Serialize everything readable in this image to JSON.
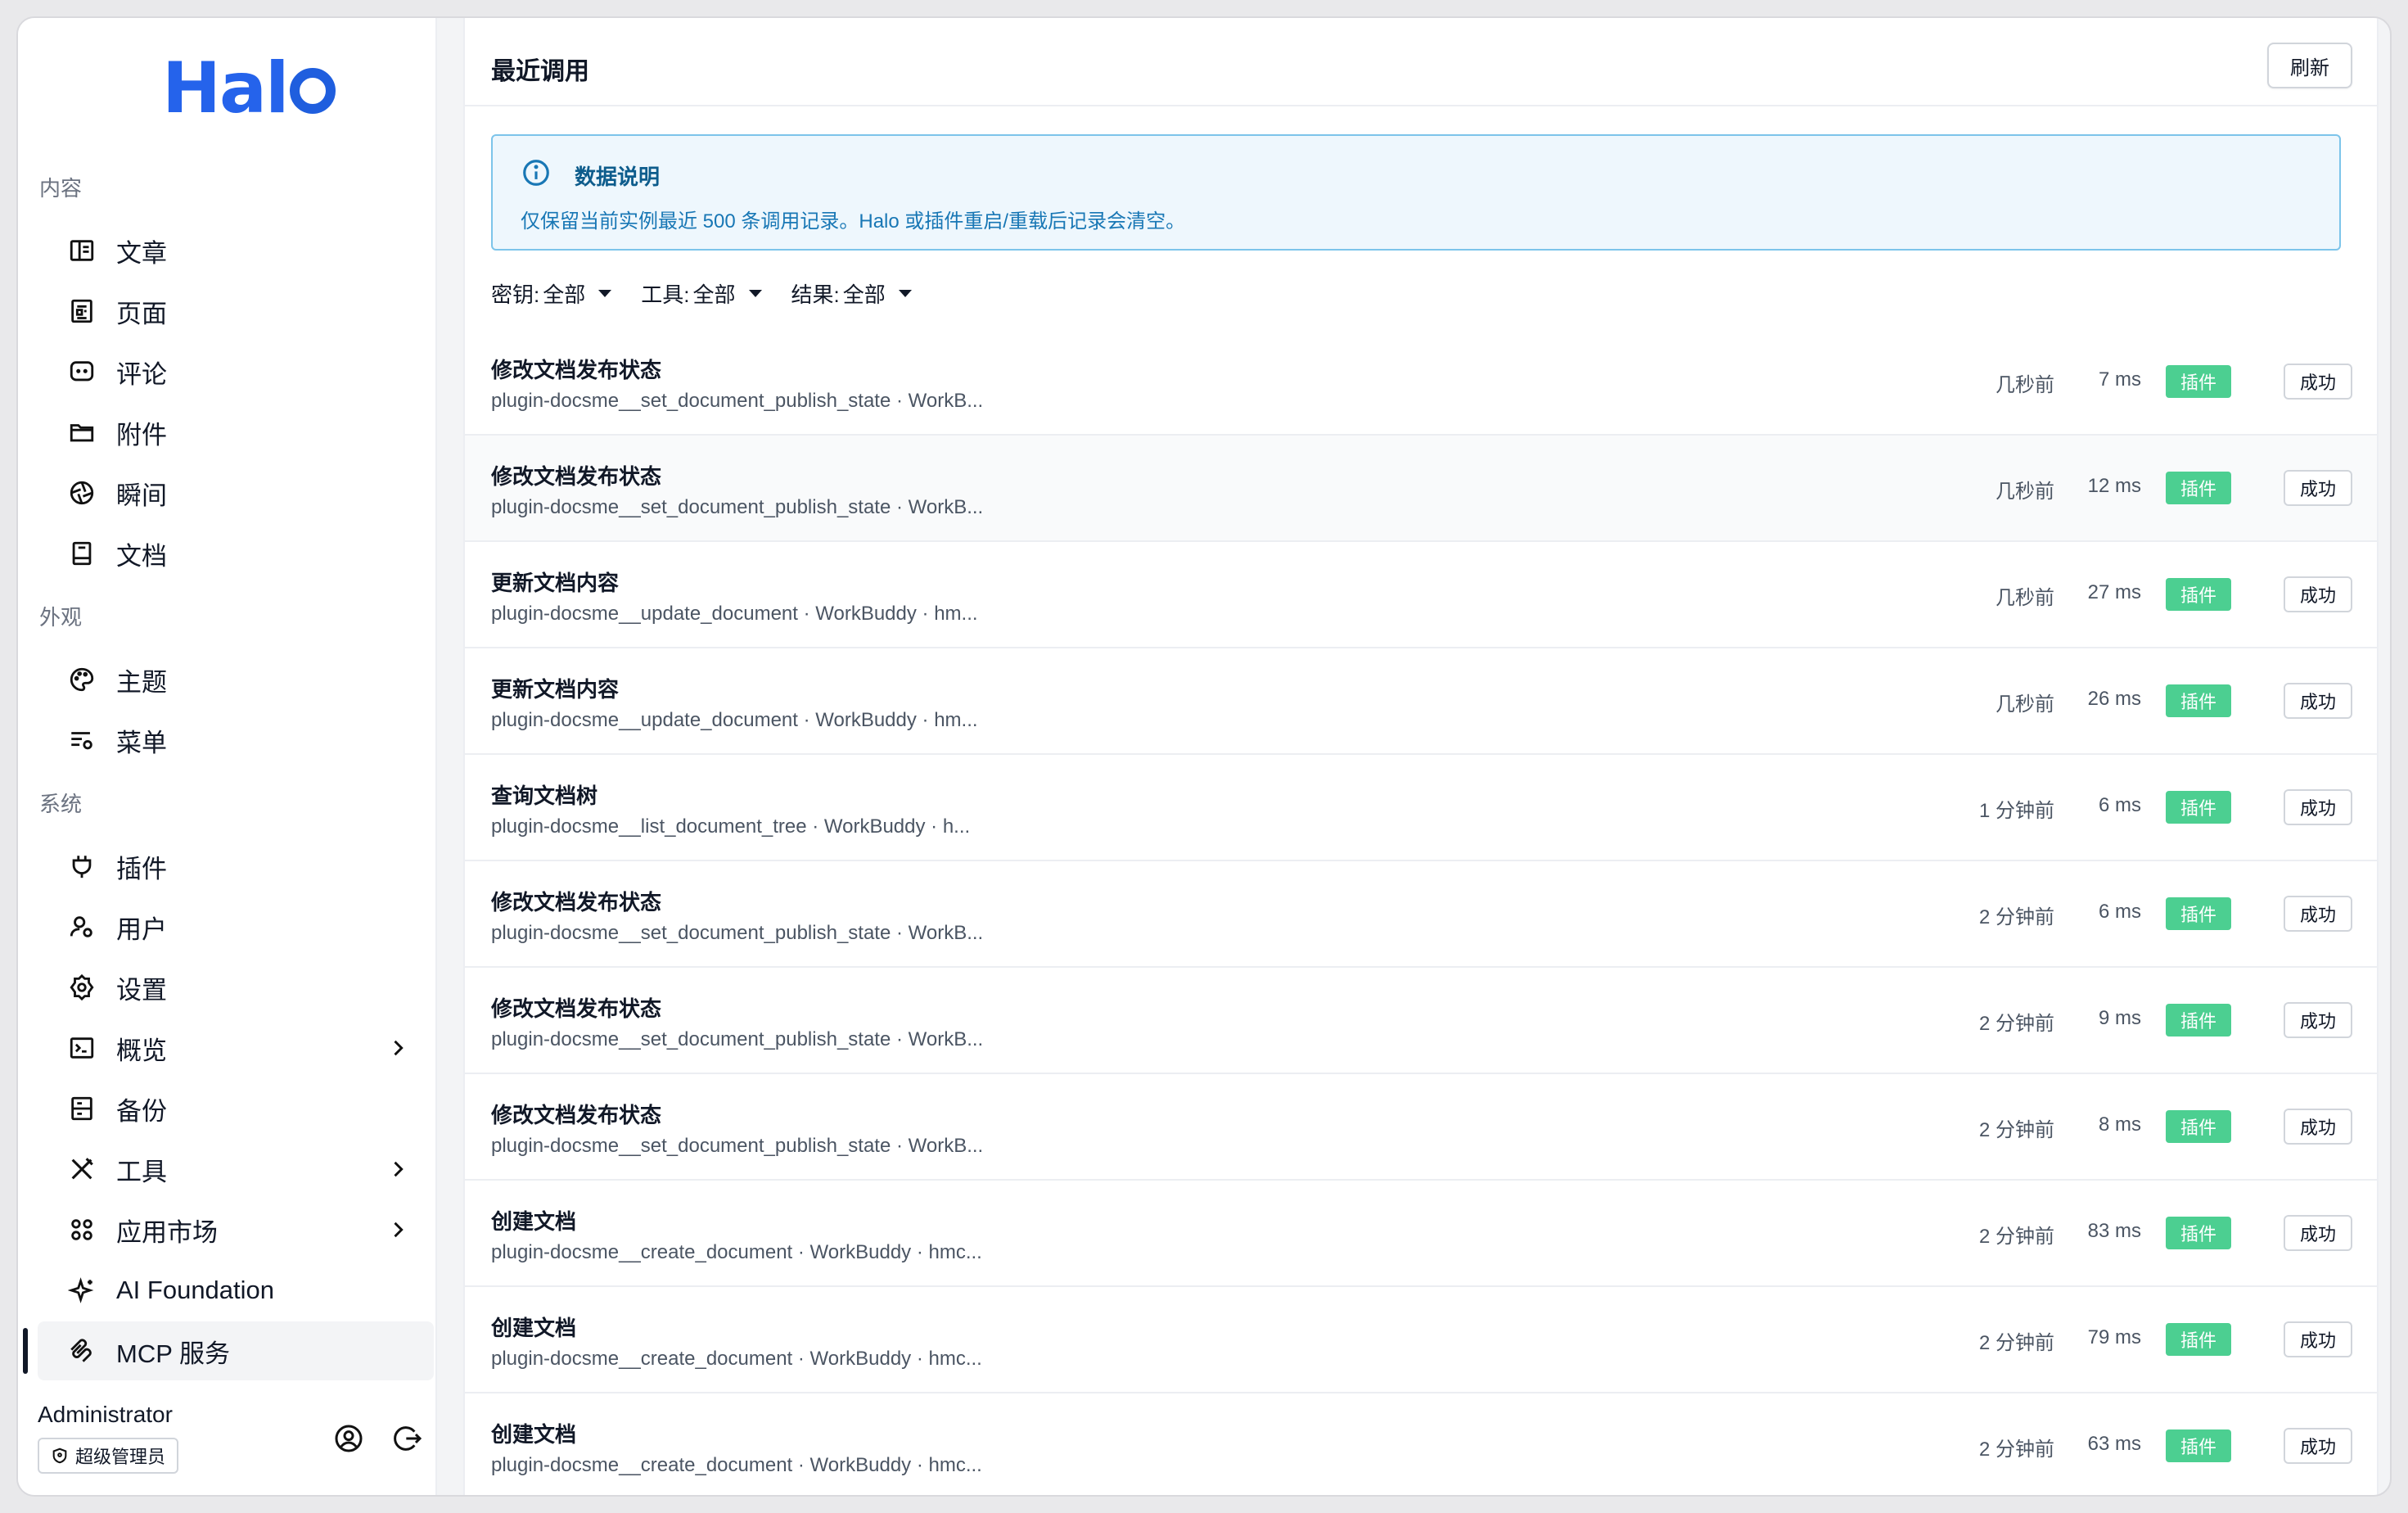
{
  "app": {
    "logo_text": "Halo"
  },
  "sidebar": {
    "groups": {
      "content": "内容",
      "appearance": "外观",
      "system": "系统"
    },
    "items": [
      {
        "key": "posts",
        "label": "文章",
        "icon": "book-open-icon"
      },
      {
        "key": "pages",
        "label": "页面",
        "icon": "page-icon"
      },
      {
        "key": "comments",
        "label": "评论",
        "icon": "comment-icon"
      },
      {
        "key": "attachments",
        "label": "附件",
        "icon": "folder-icon"
      },
      {
        "key": "moments",
        "label": "瞬间",
        "icon": "aperture-icon"
      },
      {
        "key": "docs",
        "label": "文档",
        "icon": "notebook-icon"
      },
      {
        "key": "themes",
        "label": "主题",
        "icon": "palette-icon"
      },
      {
        "key": "menus",
        "label": "菜单",
        "icon": "menu-settings-icon"
      },
      {
        "key": "plugins",
        "label": "插件",
        "icon": "plug-icon"
      },
      {
        "key": "users",
        "label": "用户",
        "icon": "user-settings-icon"
      },
      {
        "key": "settings",
        "label": "设置",
        "icon": "gear-icon"
      },
      {
        "key": "overview",
        "label": "概览",
        "icon": "terminal-icon"
      },
      {
        "key": "backup",
        "label": "备份",
        "icon": "archive-icon"
      },
      {
        "key": "tools",
        "label": "工具",
        "icon": "tools-icon"
      },
      {
        "key": "market",
        "label": "应用市场",
        "icon": "apps-grid-icon"
      },
      {
        "key": "ai",
        "label": "AI Foundation",
        "icon": "sparkle-icon"
      },
      {
        "key": "mcp",
        "label": "MCP 服务",
        "icon": "mcp-icon"
      }
    ],
    "user": {
      "name": "Administrator",
      "role": "超级管理员"
    }
  },
  "main": {
    "title": "最近调用",
    "refresh_label": "刷新",
    "notice": {
      "title": "数据说明",
      "body": "仅保留当前实例最近 500 条调用记录。Halo 或插件重启/重载后记录会清空。"
    },
    "filters": [
      {
        "label": "密钥:",
        "value": "全部"
      },
      {
        "label": "工具:",
        "value": "全部"
      },
      {
        "label": "结果:",
        "value": "全部"
      }
    ],
    "rows": [
      {
        "title": "修改文档发布状态",
        "sub": "plugin-docsme__set_document_publish_state · WorkB...",
        "time": "几秒前",
        "duration": "7 ms",
        "tag": "插件",
        "status": "成功"
      },
      {
        "title": "修改文档发布状态",
        "sub": "plugin-docsme__set_document_publish_state · WorkB...",
        "time": "几秒前",
        "duration": "12 ms",
        "tag": "插件",
        "status": "成功"
      },
      {
        "title": "更新文档内容",
        "sub": "plugin-docsme__update_document · WorkBuddy · hm...",
        "time": "几秒前",
        "duration": "27 ms",
        "tag": "插件",
        "status": "成功"
      },
      {
        "title": "更新文档内容",
        "sub": "plugin-docsme__update_document · WorkBuddy · hm...",
        "time": "几秒前",
        "duration": "26 ms",
        "tag": "插件",
        "status": "成功"
      },
      {
        "title": "查询文档树",
        "sub": "plugin-docsme__list_document_tree · WorkBuddy · h...",
        "time": "1 分钟前",
        "duration": "6 ms",
        "tag": "插件",
        "status": "成功"
      },
      {
        "title": "修改文档发布状态",
        "sub": "plugin-docsme__set_document_publish_state · WorkB...",
        "time": "2 分钟前",
        "duration": "6 ms",
        "tag": "插件",
        "status": "成功"
      },
      {
        "title": "修改文档发布状态",
        "sub": "plugin-docsme__set_document_publish_state · WorkB...",
        "time": "2 分钟前",
        "duration": "9 ms",
        "tag": "插件",
        "status": "成功"
      },
      {
        "title": "修改文档发布状态",
        "sub": "plugin-docsme__set_document_publish_state · WorkB...",
        "time": "2 分钟前",
        "duration": "8 ms",
        "tag": "插件",
        "status": "成功"
      },
      {
        "title": "创建文档",
        "sub": "plugin-docsme__create_document · WorkBuddy · hmc...",
        "time": "2 分钟前",
        "duration": "83 ms",
        "tag": "插件",
        "status": "成功"
      },
      {
        "title": "创建文档",
        "sub": "plugin-docsme__create_document · WorkBuddy · hmc...",
        "time": "2 分钟前",
        "duration": "79 ms",
        "tag": "插件",
        "status": "成功"
      },
      {
        "title": "创建文档",
        "sub": "plugin-docsme__create_document · WorkBuddy · hmc...",
        "time": "2 分钟前",
        "duration": "63 ms",
        "tag": "插件",
        "status": "成功"
      }
    ]
  },
  "colors": {
    "brand": "#2563eb",
    "plugin_tag": "#4ccf91",
    "notice_border": "#7cc4ea"
  }
}
